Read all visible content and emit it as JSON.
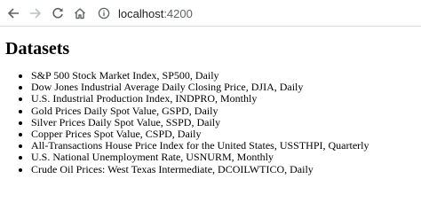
{
  "browser": {
    "url_host": "localhost",
    "url_port": ":4200"
  },
  "page": {
    "title": "Datasets",
    "datasets": [
      "S&P 500 Stock Market Index, SP500, Daily",
      "Dow Jones Industrial Average Daily Closing Price, DJIA, Daily",
      "U.S. Industrial Production Index, INDPRO, Monthly",
      "Gold Prices Daily Spot Value, GSPD, Daily",
      "Silver Prices Daily Spot Value, SSPD, Daily",
      "Copper Prices Spot Value, CSPD, Daily",
      "All-Transactions House Price Index for the United States, USSTHPI, Quarterly",
      "U.S. National Unemployment Rate, USNURM, Monthly",
      "Crude Oil Prices: West Texas Intermediate, DCOILWTICO, Daily"
    ]
  },
  "colors": {
    "toolbar_icon": "#5f6368",
    "toolbar_icon_disabled": "#bdc1c6",
    "text": "#000000"
  },
  "icons": {
    "back": "arrow-left",
    "forward": "arrow-right",
    "reload": "circular-arrow",
    "home": "house",
    "site_info": "info-circle"
  }
}
